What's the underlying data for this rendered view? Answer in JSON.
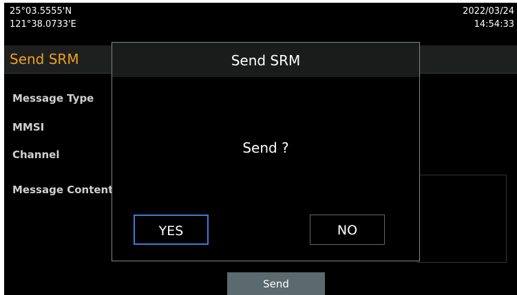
{
  "status": {
    "latitude": "25°03.5555'N",
    "longitude": "121°38.0733'E",
    "date": "2022/03/24",
    "time": "14:54:33"
  },
  "page": {
    "title": "Send SRM",
    "fields": [
      {
        "label": "Message Type"
      },
      {
        "label": "MMSI"
      },
      {
        "label": "Channel"
      },
      {
        "label": "Message Content"
      }
    ],
    "send_label": "Send"
  },
  "dialog": {
    "title": "Send SRM",
    "message": "Send ?",
    "yes_label": "YES",
    "no_label": "NO"
  },
  "colors": {
    "accent": "#f0a020",
    "focus_border": "#3b7ed6",
    "send_button": "#5a6a6e"
  }
}
